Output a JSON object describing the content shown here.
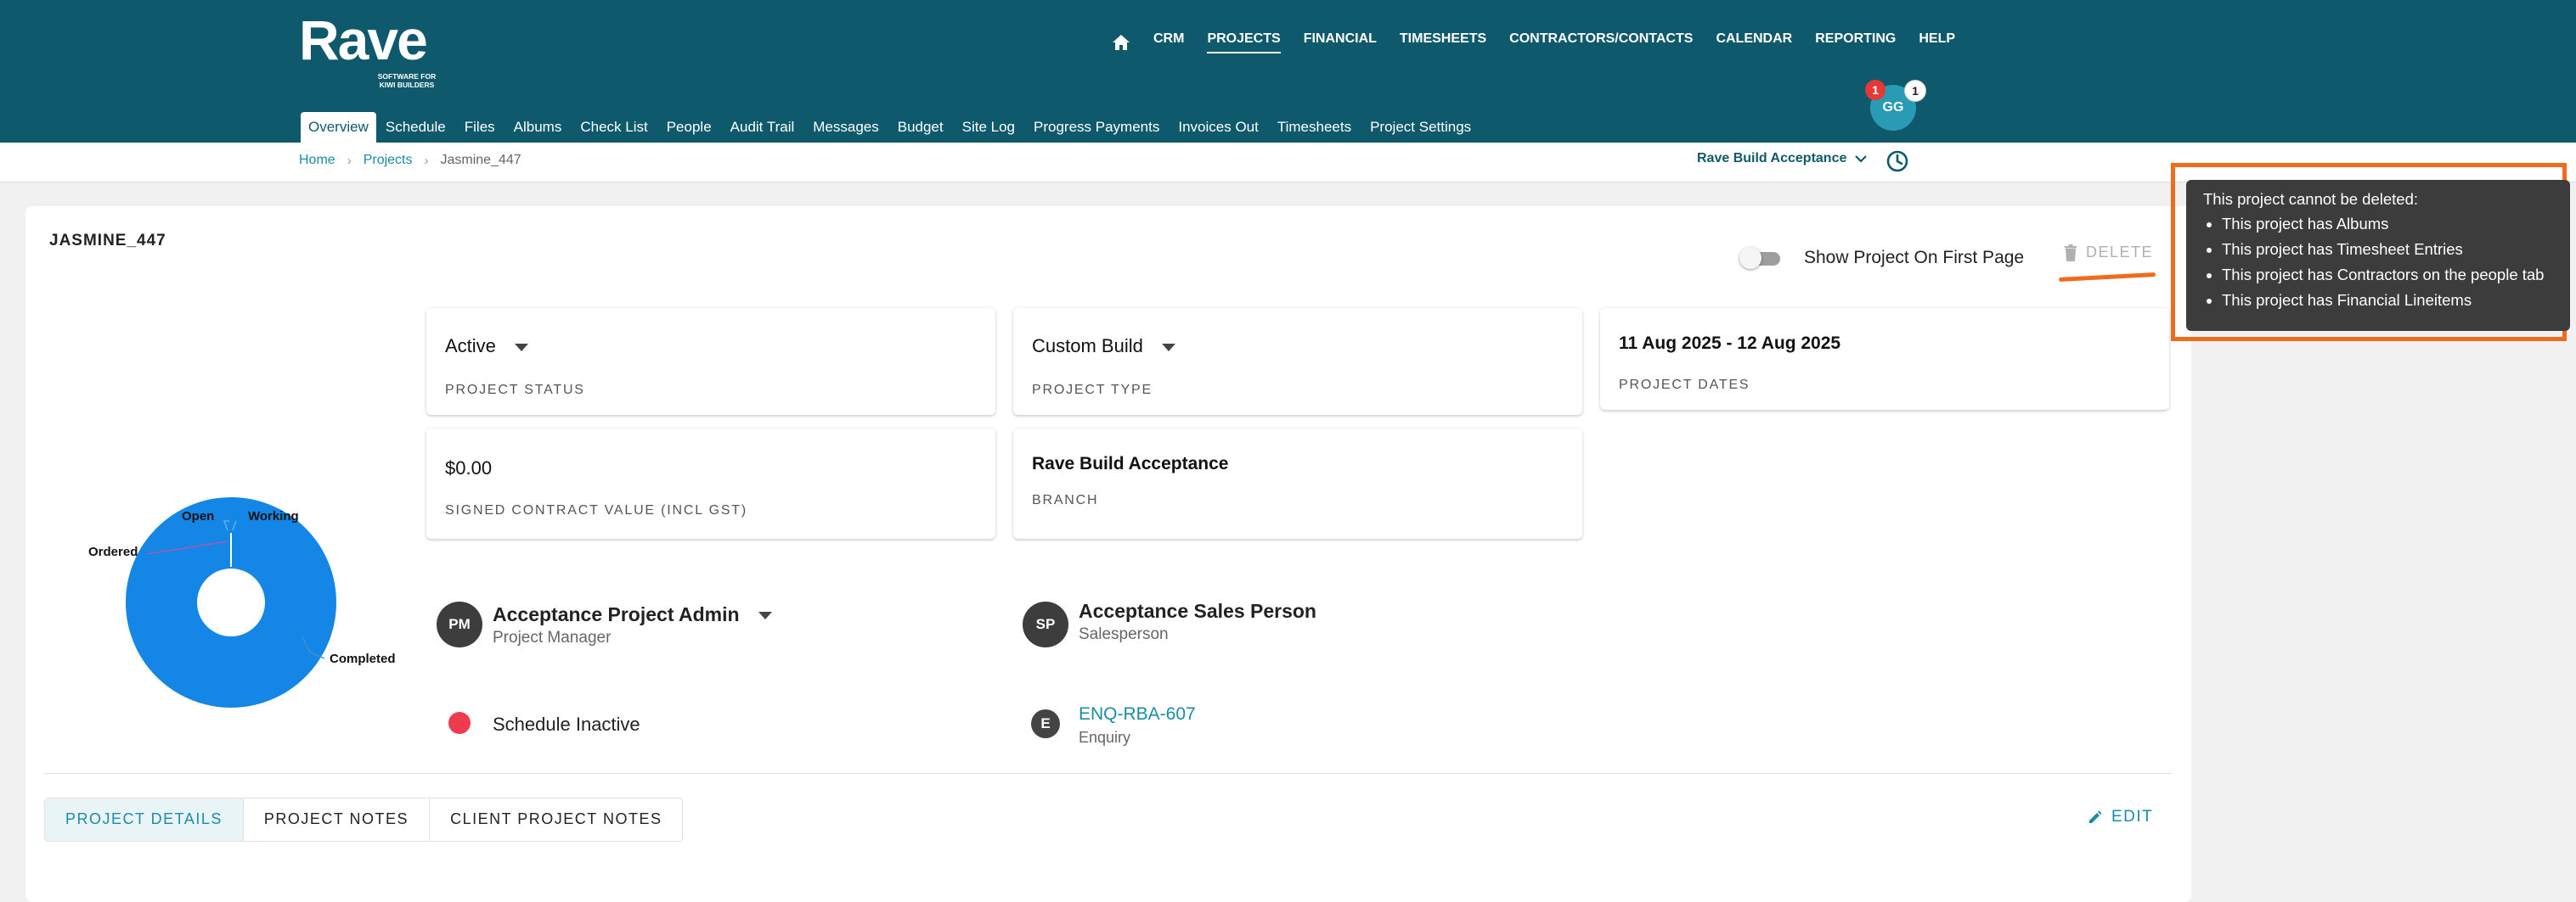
{
  "logo": {
    "name": "Rave",
    "tagline_line1": "SOFTWARE FOR",
    "tagline_line2": "KIWI BUILDERS"
  },
  "top_nav": [
    "CRM",
    "PROJECTS",
    "FINANCIAL",
    "TIMESHEETS",
    "CONTRACTORS/CONTACTS",
    "CALENDAR",
    "REPORTING",
    "HELP"
  ],
  "top_nav_active": "PROJECTS",
  "sub_nav": [
    "Overview",
    "Schedule",
    "Files",
    "Albums",
    "Check List",
    "People",
    "Audit Trail",
    "Messages",
    "Budget",
    "Site Log",
    "Progress Payments",
    "Invoices Out",
    "Timesheets",
    "Project Settings"
  ],
  "sub_nav_active": "Overview",
  "user": {
    "initials": "GG",
    "notifications_red": "1",
    "notifications_white": "1"
  },
  "breadcrumb": {
    "home": "Home",
    "projects": "Projects",
    "current": "Jasmine_447"
  },
  "branch_selector": "Rave Build Acceptance",
  "project": {
    "title": "JASMINE_447",
    "show_first_page_label": "Show Project On First Page",
    "delete_label": "DELETE"
  },
  "info_cards": {
    "status": {
      "value": "Active",
      "label": "PROJECT STATUS"
    },
    "type": {
      "value": "Custom Build",
      "label": "PROJECT TYPE"
    },
    "dates": {
      "value": "11 Aug 2025  - 12 Aug 2025",
      "label": "PROJECT DATES"
    },
    "contract": {
      "value": "$0.00",
      "label": "SIGNED CONTRACT VALUE (INCL GST)"
    },
    "branch": {
      "value": "Rave Build Acceptance",
      "label": "BRANCH"
    }
  },
  "people": {
    "manager": {
      "initials": "PM",
      "name": "Acceptance Project Admin",
      "role": "Project Manager"
    },
    "sales": {
      "initials": "SP",
      "name": "Acceptance Sales Person",
      "role": "Salesperson"
    }
  },
  "schedule_status": "Schedule Inactive",
  "enquiry": {
    "initial": "E",
    "code": "ENQ-RBA-607",
    "label": "Enquiry"
  },
  "bottom_tabs": [
    "PROJECT DETAILS",
    "PROJECT NOTES",
    "CLIENT PROJECT NOTES"
  ],
  "bottom_tabs_active": "PROJECT DETAILS",
  "edit_label": "EDIT",
  "tooltip": {
    "title": "This project cannot be deleted:",
    "items": [
      "This project has Albums",
      "This project has Timesheet Entries",
      "This project has Contractors on the people tab",
      "This project has Financial Lineitems"
    ]
  },
  "colors": {
    "header": "#0e5a6c",
    "accent": "#1a8ba8",
    "highlight": "#ef6c1e",
    "donut": "#1487e6",
    "status_red": "#ef3b4f"
  },
  "chart_data": {
    "type": "pie",
    "categories": [
      "Ordered",
      "Open",
      "Working",
      "Completed"
    ],
    "values": [
      0.5,
      0.25,
      0.25,
      99
    ],
    "title": "",
    "legend": "none",
    "donut_color": "#1487e6"
  }
}
